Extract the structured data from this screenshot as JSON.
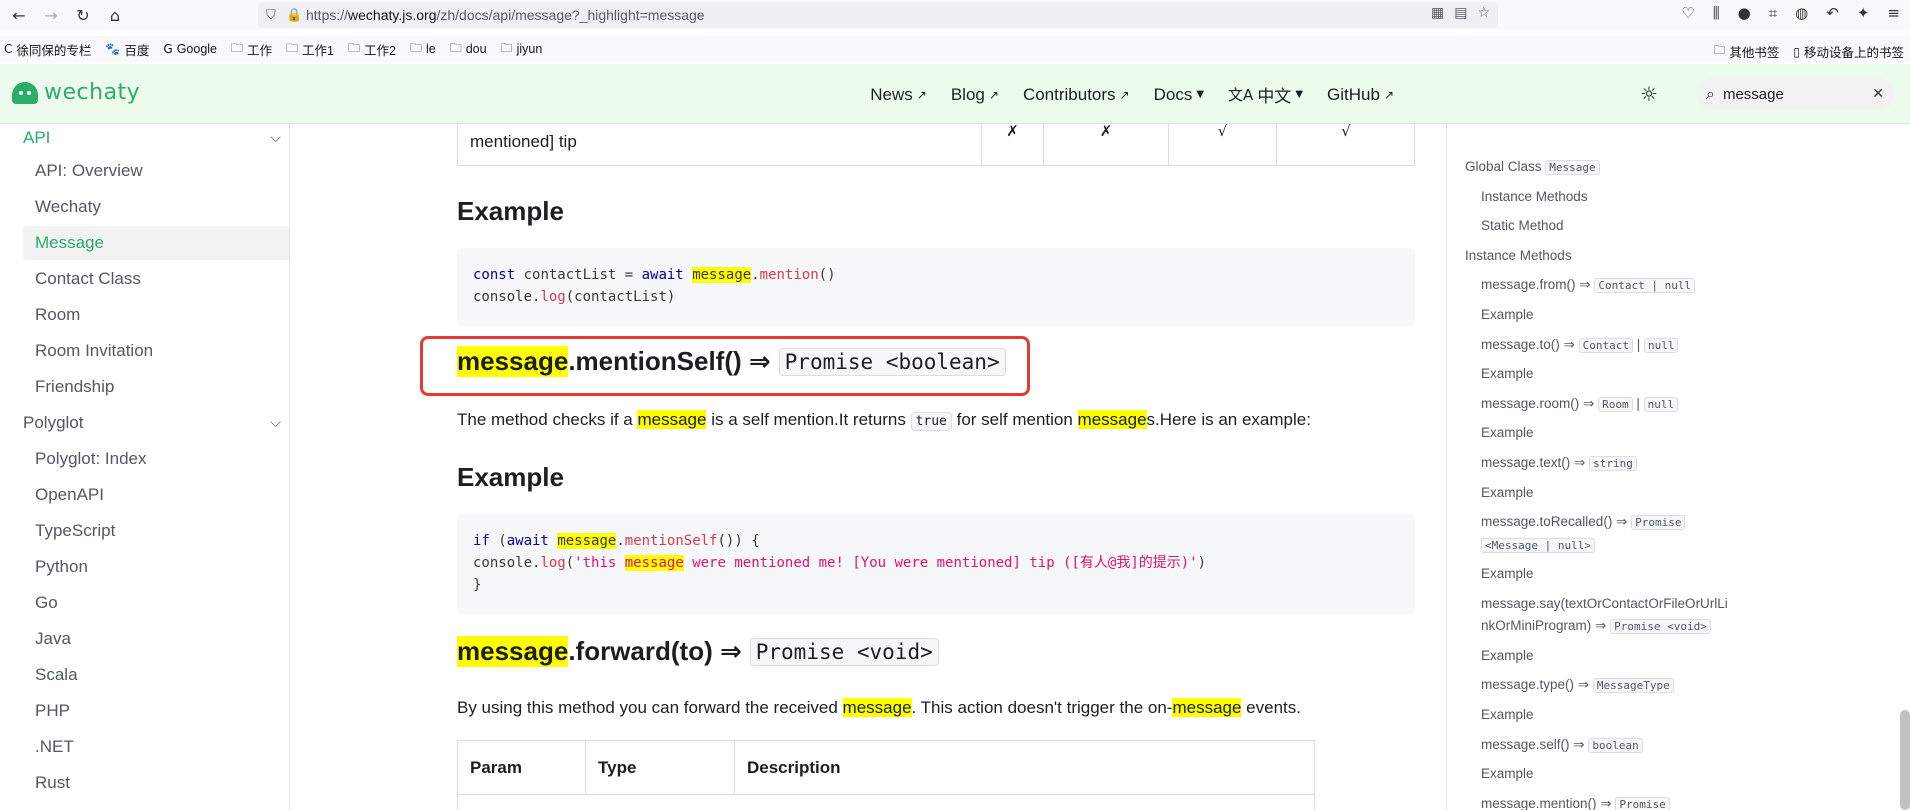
{
  "browser": {
    "url_prefix": "https://",
    "url_host": "wechaty.js.org",
    "url_path": "/zh/docs/api/message?_highlight=message",
    "bookmarks": [
      {
        "icon": "C",
        "label": "徐同保的专栏"
      },
      {
        "icon": "🐾",
        "label": "百度"
      },
      {
        "icon": "G",
        "label": "Google"
      },
      {
        "icon": "🗀",
        "label": "工作"
      },
      {
        "icon": "🗀",
        "label": "工作1"
      },
      {
        "icon": "🗀",
        "label": "工作2"
      },
      {
        "icon": "🗀",
        "label": "le"
      },
      {
        "icon": "🗀",
        "label": "dou"
      },
      {
        "icon": "🗀",
        "label": "jiyun"
      }
    ],
    "bookmarks_right": [
      {
        "icon": "🗀",
        "label": "其他书签"
      },
      {
        "icon": "▯",
        "label": "移动设备上的书签"
      }
    ]
  },
  "site": {
    "logo_text": "wechaty",
    "nav": {
      "news": "News",
      "blog": "Blog",
      "contributors": "Contributors",
      "docs": "Docs",
      "lang": "中文",
      "github": "GitHub"
    },
    "search_value": "message"
  },
  "sidebar": {
    "cat_api": "API",
    "api_items": [
      "API: Overview",
      "Wechaty",
      "Message",
      "Contact Class",
      "Room",
      "Room Invitation",
      "Friendship"
    ],
    "cat_polyglot": "Polyglot",
    "polyglot_items": [
      "Polyglot: Index",
      "OpenAPI",
      "TypeScript",
      "Python",
      "Go",
      "Java",
      "Scala",
      "PHP",
      ".NET",
      "Rust"
    ]
  },
  "content": {
    "top_row_tip": "mentioned] tip",
    "top_row_marks": [
      "✗",
      "✗",
      "√",
      "√"
    ],
    "example1_title": "Example",
    "code1": {
      "l1_a": "const",
      "l1_b": " contactList = ",
      "l1_c": "await",
      "l1_d": " ",
      "l1_e": "message",
      "l1_f": ".",
      "l1_g": "mention",
      "l1_h": "()",
      "l2_a": "console.",
      "l2_b": "log",
      "l2_c": "(contactList)"
    },
    "mentionself_hl": "message",
    "mentionself_rest": ".mentionSelf() ⇒",
    "mentionself_type": "Promise <boolean>",
    "mentionself_desc_a": "The method checks if a ",
    "mentionself_desc_hl": "message",
    "mentionself_desc_b": " is a self mention.It returns ",
    "mentionself_desc_code": "true",
    "mentionself_desc_c": " for self mention ",
    "mentionself_desc_hl2": "message",
    "mentionself_desc_d": "s.Here is an example:",
    "example2_title": "Example",
    "code2": {
      "l1_a": "if",
      "l1_b": " (",
      "l1_c": "await",
      "l1_d": " ",
      "l1_e": "message",
      "l1_f": ".",
      "l1_g": "mentionSelf",
      "l1_h": "()) {",
      "l2_a": " console.",
      "l2_b": "log",
      "l2_c": "(",
      "l2_d": "'this ",
      "l2_e": "message",
      "l2_f": " were mentioned me! [You were mentioned] tip ([有人@我]的提示)'",
      "l2_g": ")",
      "l3": "}"
    },
    "forward_hl": "message",
    "forward_rest": ".forward(to) ⇒",
    "forward_type": "Promise <void>",
    "forward_desc_a": "By using this method you can forward the received ",
    "forward_desc_hl": "message",
    "forward_desc_b": ". This action doesn't trigger the on-",
    "forward_desc_hl2": "message",
    "forward_desc_c": " events.",
    "table_headers": [
      "Param",
      "Type",
      "Description"
    ]
  },
  "toc": {
    "items": [
      {
        "level": 1,
        "text": "Global Class ",
        "code": "Message"
      },
      {
        "level": 2,
        "text": "Instance Methods"
      },
      {
        "level": 2,
        "text": "Static Method"
      },
      {
        "level": 1,
        "text": "Instance Methods"
      },
      {
        "level": 2,
        "text": "message.from() ⇒ ",
        "code": "Contact | null"
      },
      {
        "level": 2,
        "text": "Example"
      },
      {
        "level": 2,
        "text": "message.to() ⇒ ",
        "code": "Contact",
        "text2": " | ",
        "code2": "null"
      },
      {
        "level": 2,
        "text": "Example"
      },
      {
        "level": 2,
        "text": "message.room() ⇒ ",
        "code": "Room",
        "text2": " | ",
        "code2": "null"
      },
      {
        "level": 2,
        "text": "Example"
      },
      {
        "level": 2,
        "text": "message.text() ⇒ ",
        "code": "string"
      },
      {
        "level": 2,
        "text": "Example"
      },
      {
        "level": 2,
        "text": "message.toRecalled() ⇒ ",
        "code": "Promise",
        "code_line2": "<Message | null>"
      },
      {
        "level": 2,
        "text": "Example"
      },
      {
        "level": 2,
        "text": "message.say(textOrContactOrFileOrUrlLi",
        "text_line2": "nkOrMiniProgram) ⇒ ",
        "code": "Promise <void>"
      },
      {
        "level": 2,
        "text": "Example"
      },
      {
        "level": 2,
        "text": "message.type() ⇒ ",
        "code": "MessageType"
      },
      {
        "level": 2,
        "text": "Example"
      },
      {
        "level": 2,
        "text": "message.self() ⇒ ",
        "code": "boolean"
      },
      {
        "level": 2,
        "text": "Example"
      },
      {
        "level": 2,
        "text": "message.mention() ⇒ ",
        "code": "Promise"
      }
    ]
  }
}
